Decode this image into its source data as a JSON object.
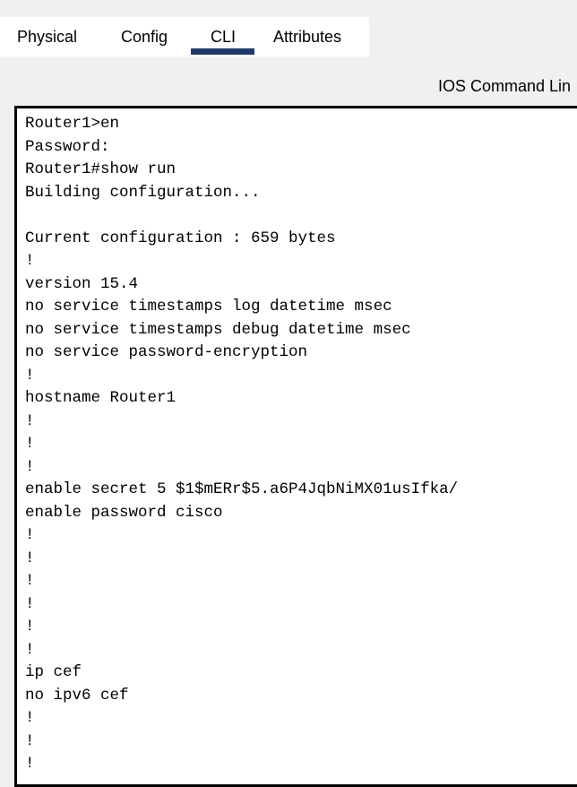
{
  "tabs": [
    {
      "label": "Physical",
      "active": false
    },
    {
      "label": "Config",
      "active": false
    },
    {
      "label": "CLI",
      "active": true
    },
    {
      "label": "Attributes",
      "active": false
    }
  ],
  "panel_title": "IOS Command Lin",
  "colors": {
    "active_tab_underline": "#1f3a68",
    "console_background": "#ffffff",
    "console_border": "#000000",
    "window_background": "#f0f0f0"
  },
  "console": {
    "lines": [
      "Router1>en",
      "Password:",
      "Router1#show run",
      "Building configuration...",
      "",
      "Current configuration : 659 bytes",
      "!",
      "version 15.4",
      "no service timestamps log datetime msec",
      "no service timestamps debug datetime msec",
      "no service password-encryption",
      "!",
      "hostname Router1",
      "!",
      "!",
      "!",
      "enable secret 5 $1$mERr$5.a6P4JqbNiMX01usIfka/",
      "enable password cisco",
      "!",
      "!",
      "!",
      "!",
      "!",
      "!",
      "ip cef",
      "no ipv6 cef",
      "!",
      "!",
      "!"
    ]
  }
}
